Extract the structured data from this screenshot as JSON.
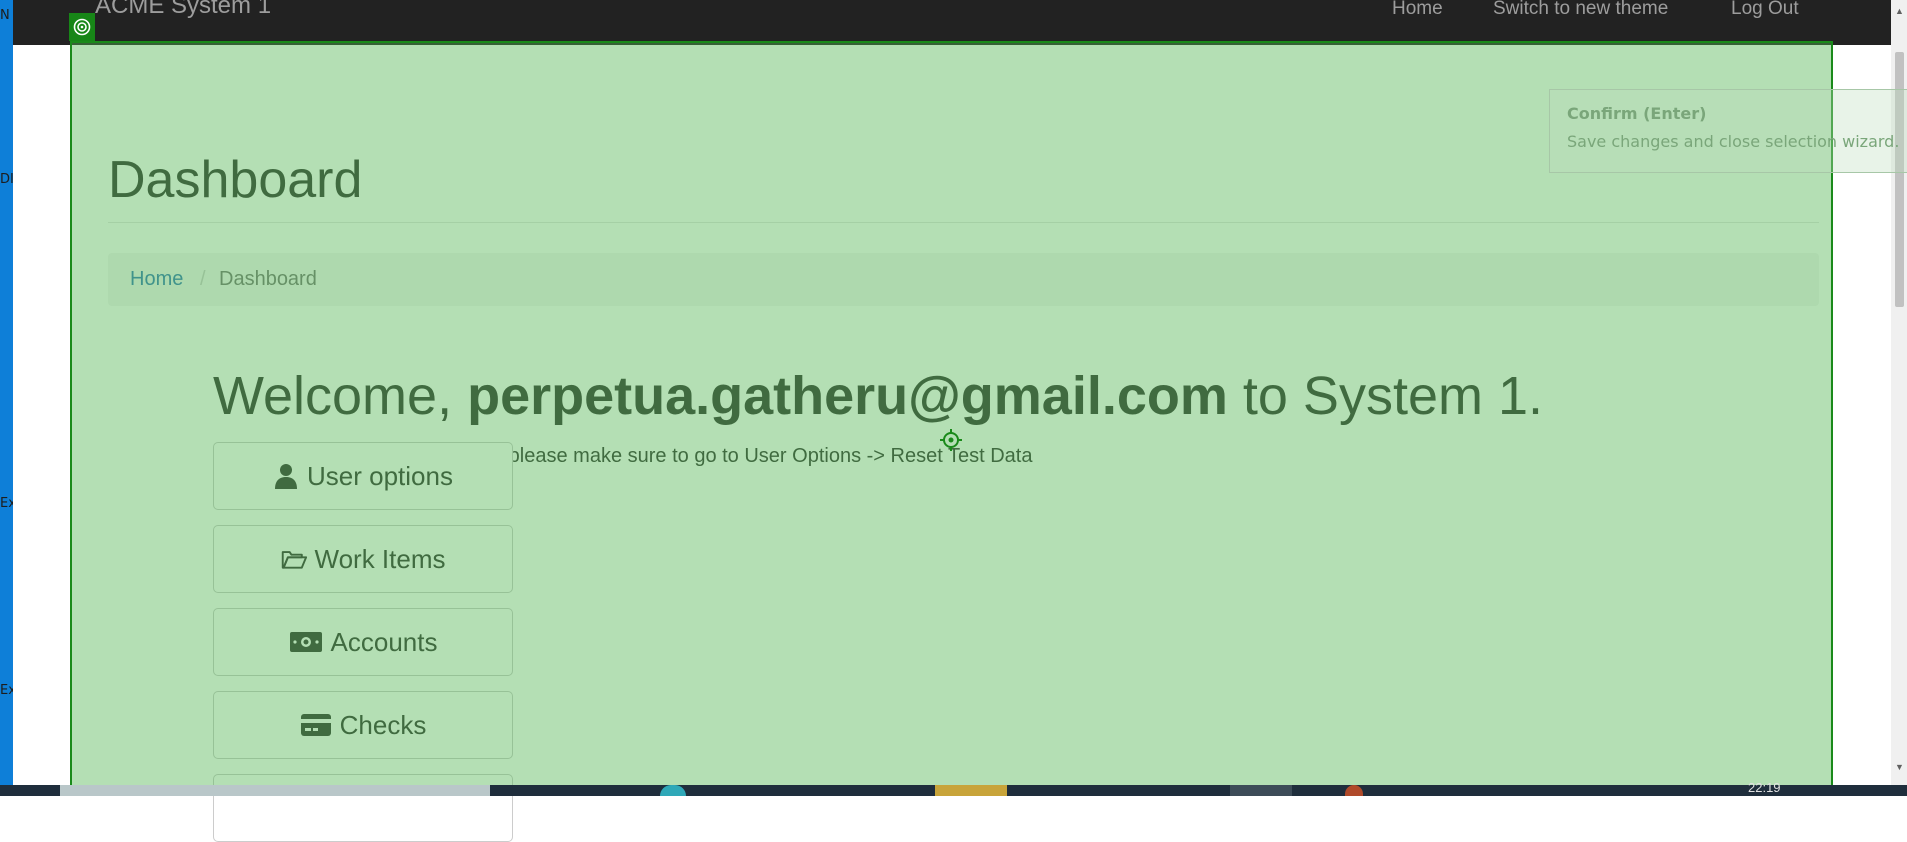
{
  "app": {
    "brand": "ACME System 1",
    "nav": [
      {
        "label": "Home"
      },
      {
        "label": "Switch to new theme"
      },
      {
        "label": "Log Out"
      }
    ]
  },
  "page": {
    "title": "Dashboard",
    "breadcrumb": {
      "home": "Home",
      "separator": "/",
      "current": "Dashboard"
    },
    "welcome": {
      "prefix": "Welcome, ",
      "user": "perpetua.gatheru@gmail.com",
      "suffix": " to System 1."
    },
    "instruction": "If this is your first time logging in, please make sure to go to User Options -> Reset Test Data",
    "buttons": [
      {
        "label": "User options",
        "icon": "user-icon"
      },
      {
        "label": "Work Items",
        "icon": "folder-open-icon"
      },
      {
        "label": "Accounts",
        "icon": "money-icon"
      },
      {
        "label": "Checks",
        "icon": "credit-card-icon"
      }
    ]
  },
  "selection_overlay": {
    "color": "#52b452",
    "tooltip": {
      "title": "Confirm (Enter)",
      "text": "Save changes and close selection wizard."
    }
  },
  "desktop": {
    "edge_letters": [
      "N",
      "DI",
      "Ex",
      "Ex"
    ]
  },
  "taskbar": {
    "clock": "22:19"
  }
}
